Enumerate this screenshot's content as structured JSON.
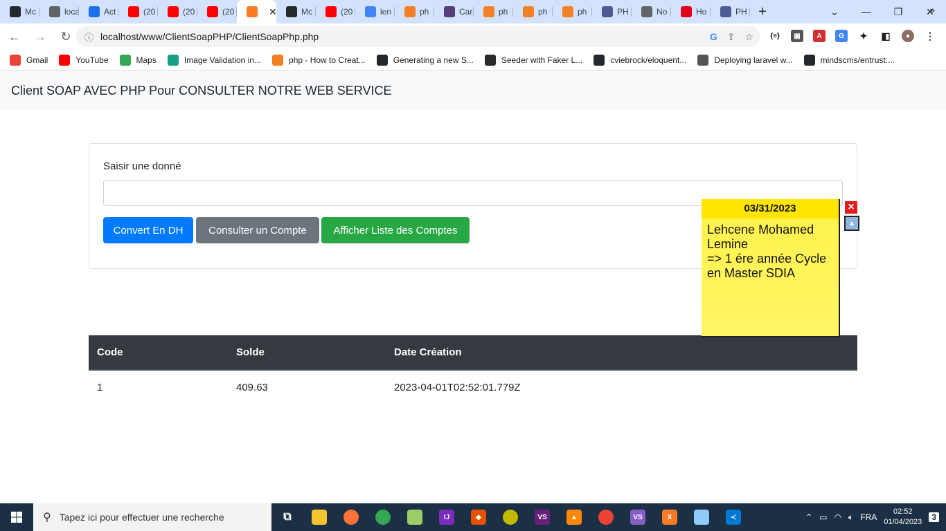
{
  "browser": {
    "tabs": [
      {
        "label": "Mc",
        "icon": "github-icon",
        "color": "#24292e"
      },
      {
        "label": "loca",
        "icon": "globe-icon",
        "color": "#5f6368"
      },
      {
        "label": "Act",
        "icon": "contacts-icon",
        "color": "#1a73e8"
      },
      {
        "label": "(20",
        "icon": "youtube-icon",
        "color": "#ff0000"
      },
      {
        "label": "(20",
        "icon": "youtube-icon",
        "color": "#ff0000"
      },
      {
        "label": "(20",
        "icon": "youtube-icon",
        "color": "#ff0000"
      },
      {
        "label": "",
        "icon": "xampp-icon",
        "color": "#fb7a24",
        "active": true
      },
      {
        "label": "Mc",
        "icon": "github-icon",
        "color": "#24292e"
      },
      {
        "label": "(20",
        "icon": "youtube-icon",
        "color": "#ff0000"
      },
      {
        "label": "len",
        "icon": "google-icon",
        "color": "#4285f4"
      },
      {
        "label": "ph",
        "icon": "stackoverflow-icon",
        "color": "#f48024"
      },
      {
        "label": "Car",
        "icon": "bootstrap-icon",
        "color": "#563d7c"
      },
      {
        "label": "ph",
        "icon": "stackoverflow-icon",
        "color": "#f48024"
      },
      {
        "label": "ph",
        "icon": "stackoverflow-icon",
        "color": "#f48024"
      },
      {
        "label": "ph",
        "icon": "stackoverflow-icon",
        "color": "#f48024"
      },
      {
        "label": "PH",
        "icon": "php-icon",
        "color": "#4f5b93"
      },
      {
        "label": "No",
        "icon": "globe-icon",
        "color": "#5f6368"
      },
      {
        "label": "Ho",
        "icon": "vuetify-icon",
        "color": "#e3001b"
      },
      {
        "label": "PH",
        "icon": "php-icon",
        "color": "#4f5b93"
      }
    ],
    "url": "localhost/www/ClientSoapPHP/ClientSoapPhp.php",
    "bookmarks": [
      {
        "label": "Gmail",
        "icon": "gmail-icon",
        "color": "#ea4335"
      },
      {
        "label": "YouTube",
        "icon": "youtube-icon",
        "color": "#ff0000"
      },
      {
        "label": "Maps",
        "icon": "maps-icon",
        "color": "#34a853"
      },
      {
        "label": "Image Validation in...",
        "icon": "ns-icon",
        "color": "#16a085"
      },
      {
        "label": "php - How to Creat...",
        "icon": "stackoverflow-icon",
        "color": "#f48024"
      },
      {
        "label": "Generating a new S...",
        "icon": "github-icon",
        "color": "#24292e"
      },
      {
        "label": "Seeder with Faker L...",
        "icon": "site-icon",
        "color": "#2b2b2b"
      },
      {
        "label": "cviebrock/eloquent...",
        "icon": "github-icon",
        "color": "#24292e"
      },
      {
        "label": "Deploying laravel w...",
        "icon": "send-icon",
        "color": "#555555"
      },
      {
        "label": "mindscms/entrust:...",
        "icon": "github-icon",
        "color": "#24292e"
      }
    ]
  },
  "page": {
    "title": "Client SOAP AVEC PHP Pour CONSULTER NOTRE WEB SERVICE",
    "form": {
      "label": "Saisir une donné",
      "input_value": "",
      "buttons": {
        "convert": "Convert En DH",
        "consult": "Consulter un Compte",
        "list": "Afficher Liste des Comptes"
      }
    },
    "table": {
      "headers": [
        "Code",
        "Solde",
        "Date Création"
      ],
      "rows": [
        [
          "1",
          "409.63",
          "2023-04-01T02:52:01.779Z"
        ]
      ]
    }
  },
  "sticky_note": {
    "date": "03/31/2023",
    "text_line1": "Lehcene Mohamed Lemine",
    "text_line2": "=> 1 ére année Cycle en Master SDIA",
    "close": "×"
  },
  "taskbar": {
    "search_placeholder": "Tapez ici pour effectuer une recherche",
    "language": "FRA",
    "time": "02:52",
    "date": "01/04/2023",
    "notifications": "3"
  }
}
